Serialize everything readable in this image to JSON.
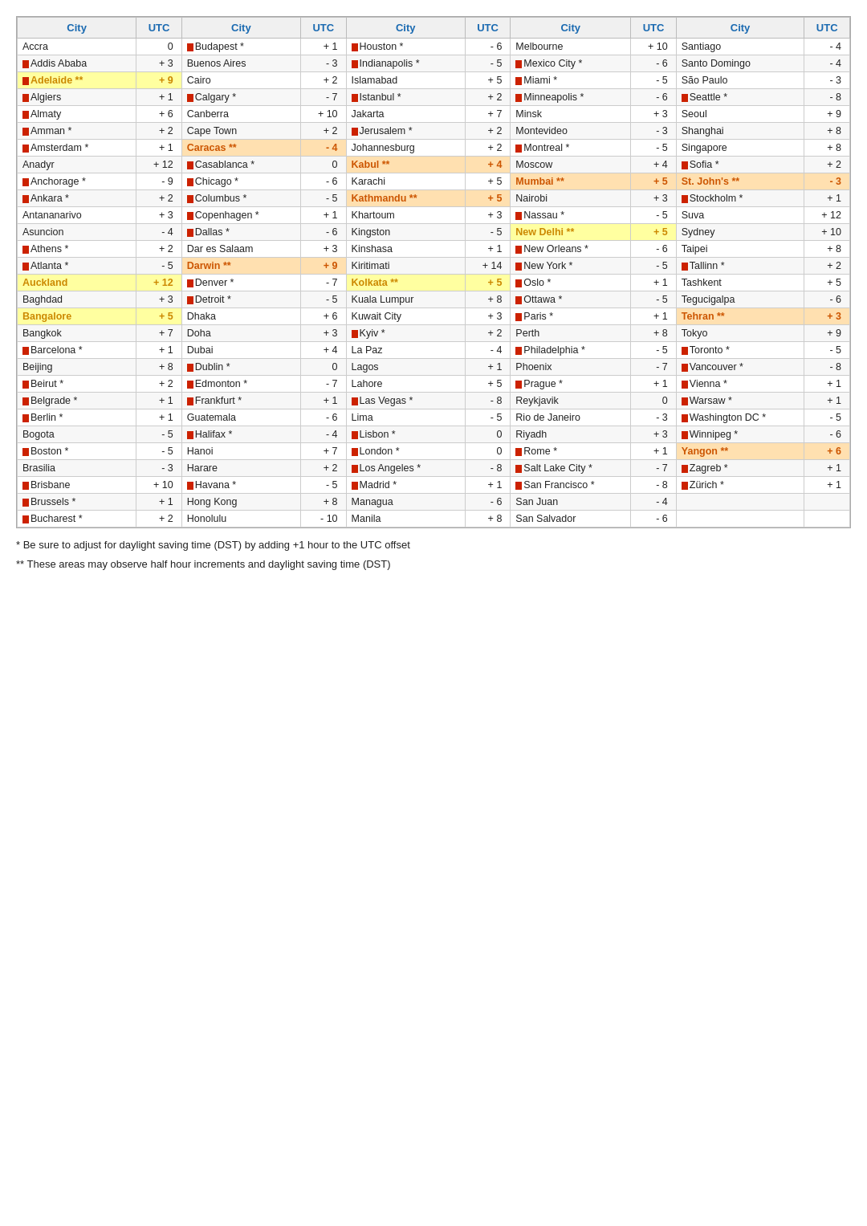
{
  "headers": [
    "City",
    "UTC",
    "City",
    "UTC",
    "City",
    "UTC",
    "City",
    "UTC",
    "City",
    "UTC"
  ],
  "columns": [
    [
      {
        "city": "Accra",
        "utc": "0",
        "flag": false,
        "highlight": ""
      },
      {
        "city": "Addis Ababa",
        "utc": "+ 3",
        "flag": true,
        "highlight": ""
      },
      {
        "city": "Adelaide **",
        "utc": "+ 9",
        "flag": true,
        "highlight": "yellow"
      },
      {
        "city": "Algiers",
        "utc": "+ 1",
        "flag": true,
        "highlight": ""
      },
      {
        "city": "Almaty",
        "utc": "+ 6",
        "flag": true,
        "highlight": ""
      },
      {
        "city": "Amman *",
        "utc": "+ 2",
        "flag": true,
        "highlight": ""
      },
      {
        "city": "Amsterdam *",
        "utc": "+ 1",
        "flag": true,
        "highlight": ""
      },
      {
        "city": "Anadyr",
        "utc": "+ 12",
        "flag": false,
        "highlight": ""
      },
      {
        "city": "Anchorage *",
        "utc": "- 9",
        "flag": true,
        "highlight": ""
      },
      {
        "city": "Ankara *",
        "utc": "+ 2",
        "flag": true,
        "highlight": ""
      },
      {
        "city": "Antananarivo",
        "utc": "+ 3",
        "flag": false,
        "highlight": ""
      },
      {
        "city": "Asuncion",
        "utc": "- 4",
        "flag": false,
        "highlight": ""
      },
      {
        "city": "Athens *",
        "utc": "+ 2",
        "flag": true,
        "highlight": ""
      },
      {
        "city": "Atlanta *",
        "utc": "- 5",
        "flag": true,
        "highlight": ""
      },
      {
        "city": "Auckland",
        "utc": "+ 12",
        "flag": false,
        "highlight": "yellow"
      },
      {
        "city": "Baghdad",
        "utc": "+ 3",
        "flag": false,
        "highlight": ""
      },
      {
        "city": "Bangalore",
        "utc": "+ 5",
        "flag": false,
        "highlight": "yellow"
      },
      {
        "city": "Bangkok",
        "utc": "+ 7",
        "flag": false,
        "highlight": ""
      },
      {
        "city": "Barcelona *",
        "utc": "+ 1",
        "flag": true,
        "highlight": ""
      },
      {
        "city": "Beijing",
        "utc": "+ 8",
        "flag": false,
        "highlight": ""
      },
      {
        "city": "Beirut *",
        "utc": "+ 2",
        "flag": true,
        "highlight": ""
      },
      {
        "city": "Belgrade *",
        "utc": "+ 1",
        "flag": true,
        "highlight": ""
      },
      {
        "city": "Berlin *",
        "utc": "+ 1",
        "flag": true,
        "highlight": ""
      },
      {
        "city": "Bogota",
        "utc": "- 5",
        "flag": false,
        "highlight": ""
      },
      {
        "city": "Boston *",
        "utc": "- 5",
        "flag": true,
        "highlight": ""
      },
      {
        "city": "Brasilia",
        "utc": "- 3",
        "flag": false,
        "highlight": ""
      },
      {
        "city": "Brisbane",
        "utc": "+ 10",
        "flag": true,
        "highlight": ""
      },
      {
        "city": "Brussels *",
        "utc": "+ 1",
        "flag": true,
        "highlight": ""
      },
      {
        "city": "Bucharest *",
        "utc": "+ 2",
        "flag": true,
        "highlight": ""
      }
    ],
    [
      {
        "city": "Budapest *",
        "utc": "+ 1",
        "flag": true,
        "highlight": ""
      },
      {
        "city": "Buenos Aires",
        "utc": "- 3",
        "flag": false,
        "highlight": ""
      },
      {
        "city": "Cairo",
        "utc": "+ 2",
        "flag": false,
        "highlight": ""
      },
      {
        "city": "Calgary *",
        "utc": "- 7",
        "flag": true,
        "highlight": ""
      },
      {
        "city": "Canberra",
        "utc": "+ 10",
        "flag": false,
        "highlight": ""
      },
      {
        "city": "Cape Town",
        "utc": "+ 2",
        "flag": false,
        "highlight": ""
      },
      {
        "city": "Caracas **",
        "utc": "- 4",
        "flag": false,
        "highlight": "orange"
      },
      {
        "city": "Casablanca *",
        "utc": "0",
        "flag": true,
        "highlight": ""
      },
      {
        "city": "Chicago *",
        "utc": "- 6",
        "flag": true,
        "highlight": ""
      },
      {
        "city": "Columbus *",
        "utc": "- 5",
        "flag": true,
        "highlight": ""
      },
      {
        "city": "Copenhagen *",
        "utc": "+ 1",
        "flag": true,
        "highlight": ""
      },
      {
        "city": "Dallas *",
        "utc": "- 6",
        "flag": true,
        "highlight": ""
      },
      {
        "city": "Dar es Salaam",
        "utc": "+ 3",
        "flag": false,
        "highlight": ""
      },
      {
        "city": "Darwin **",
        "utc": "+ 9",
        "flag": false,
        "highlight": "orange"
      },
      {
        "city": "Denver *",
        "utc": "- 7",
        "flag": true,
        "highlight": ""
      },
      {
        "city": "Detroit *",
        "utc": "- 5",
        "flag": true,
        "highlight": ""
      },
      {
        "city": "Dhaka",
        "utc": "+ 6",
        "flag": false,
        "highlight": ""
      },
      {
        "city": "Doha",
        "utc": "+ 3",
        "flag": false,
        "highlight": ""
      },
      {
        "city": "Dubai",
        "utc": "+ 4",
        "flag": false,
        "highlight": ""
      },
      {
        "city": "Dublin *",
        "utc": "0",
        "flag": true,
        "highlight": ""
      },
      {
        "city": "Edmonton *",
        "utc": "- 7",
        "flag": true,
        "highlight": ""
      },
      {
        "city": "Frankfurt *",
        "utc": "+ 1",
        "flag": true,
        "highlight": ""
      },
      {
        "city": "Guatemala",
        "utc": "- 6",
        "flag": false,
        "highlight": ""
      },
      {
        "city": "Halifax *",
        "utc": "- 4",
        "flag": true,
        "highlight": ""
      },
      {
        "city": "Hanoi",
        "utc": "+ 7",
        "flag": false,
        "highlight": ""
      },
      {
        "city": "Harare",
        "utc": "+ 2",
        "flag": false,
        "highlight": ""
      },
      {
        "city": "Havana *",
        "utc": "- 5",
        "flag": true,
        "highlight": ""
      },
      {
        "city": "Hong Kong",
        "utc": "+ 8",
        "flag": false,
        "highlight": ""
      },
      {
        "city": "Honolulu",
        "utc": "- 10",
        "flag": false,
        "highlight": ""
      }
    ],
    [
      {
        "city": "Houston *",
        "utc": "- 6",
        "flag": true,
        "highlight": ""
      },
      {
        "city": "Indianapolis *",
        "utc": "- 5",
        "flag": true,
        "highlight": ""
      },
      {
        "city": "Islamabad",
        "utc": "+ 5",
        "flag": false,
        "highlight": ""
      },
      {
        "city": "Istanbul *",
        "utc": "+ 2",
        "flag": true,
        "highlight": ""
      },
      {
        "city": "Jakarta",
        "utc": "+ 7",
        "flag": false,
        "highlight": ""
      },
      {
        "city": "Jerusalem *",
        "utc": "+ 2",
        "flag": true,
        "highlight": ""
      },
      {
        "city": "Johannesburg",
        "utc": "+ 2",
        "flag": false,
        "highlight": ""
      },
      {
        "city": "Kabul **",
        "utc": "+ 4",
        "flag": false,
        "highlight": "orange"
      },
      {
        "city": "Karachi",
        "utc": "+ 5",
        "flag": false,
        "highlight": ""
      },
      {
        "city": "Kathmandu **",
        "utc": "+ 5",
        "flag": false,
        "highlight": "orange"
      },
      {
        "city": "Khartoum",
        "utc": "+ 3",
        "flag": false,
        "highlight": ""
      },
      {
        "city": "Kingston",
        "utc": "- 5",
        "flag": false,
        "highlight": ""
      },
      {
        "city": "Kinshasa",
        "utc": "+ 1",
        "flag": false,
        "highlight": ""
      },
      {
        "city": "Kiritimati",
        "utc": "+ 14",
        "flag": false,
        "highlight": ""
      },
      {
        "city": "Kolkata **",
        "utc": "+ 5",
        "flag": false,
        "highlight": "yellow"
      },
      {
        "city": "Kuala Lumpur",
        "utc": "+ 8",
        "flag": false,
        "highlight": ""
      },
      {
        "city": "Kuwait City",
        "utc": "+ 3",
        "flag": false,
        "highlight": ""
      },
      {
        "city": "Kyiv *",
        "utc": "+ 2",
        "flag": true,
        "highlight": ""
      },
      {
        "city": "La Paz",
        "utc": "- 4",
        "flag": false,
        "highlight": ""
      },
      {
        "city": "Lagos",
        "utc": "+ 1",
        "flag": false,
        "highlight": ""
      },
      {
        "city": "Lahore",
        "utc": "+ 5",
        "flag": false,
        "highlight": ""
      },
      {
        "city": "Las Vegas *",
        "utc": "- 8",
        "flag": true,
        "highlight": ""
      },
      {
        "city": "Lima",
        "utc": "- 5",
        "flag": false,
        "highlight": ""
      },
      {
        "city": "Lisbon *",
        "utc": "0",
        "flag": true,
        "highlight": ""
      },
      {
        "city": "London *",
        "utc": "0",
        "flag": true,
        "highlight": ""
      },
      {
        "city": "Los Angeles *",
        "utc": "- 8",
        "flag": true,
        "highlight": ""
      },
      {
        "city": "Madrid *",
        "utc": "+ 1",
        "flag": true,
        "highlight": ""
      },
      {
        "city": "Managua",
        "utc": "- 6",
        "flag": false,
        "highlight": ""
      },
      {
        "city": "Manila",
        "utc": "+ 8",
        "flag": false,
        "highlight": ""
      }
    ],
    [
      {
        "city": "Melbourne",
        "utc": "+ 10",
        "flag": false,
        "highlight": ""
      },
      {
        "city": "Mexico City *",
        "utc": "- 6",
        "flag": true,
        "highlight": ""
      },
      {
        "city": "Miami *",
        "utc": "- 5",
        "flag": true,
        "highlight": ""
      },
      {
        "city": "Minneapolis *",
        "utc": "- 6",
        "flag": true,
        "highlight": ""
      },
      {
        "city": "Minsk",
        "utc": "+ 3",
        "flag": false,
        "highlight": ""
      },
      {
        "city": "Montevideo",
        "utc": "- 3",
        "flag": false,
        "highlight": ""
      },
      {
        "city": "Montreal *",
        "utc": "- 5",
        "flag": true,
        "highlight": ""
      },
      {
        "city": "Moscow",
        "utc": "+ 4",
        "flag": false,
        "highlight": ""
      },
      {
        "city": "Mumbai **",
        "utc": "+ 5",
        "flag": false,
        "highlight": "orange"
      },
      {
        "city": "Nairobi",
        "utc": "+ 3",
        "flag": false,
        "highlight": ""
      },
      {
        "city": "Nassau *",
        "utc": "- 5",
        "flag": true,
        "highlight": ""
      },
      {
        "city": "New Delhi **",
        "utc": "+ 5",
        "flag": false,
        "highlight": "yellow"
      },
      {
        "city": "New Orleans *",
        "utc": "- 6",
        "flag": true,
        "highlight": ""
      },
      {
        "city": "New York *",
        "utc": "- 5",
        "flag": true,
        "highlight": ""
      },
      {
        "city": "Oslo *",
        "utc": "+ 1",
        "flag": true,
        "highlight": ""
      },
      {
        "city": "Ottawa *",
        "utc": "- 5",
        "flag": true,
        "highlight": ""
      },
      {
        "city": "Paris *",
        "utc": "+ 1",
        "flag": true,
        "highlight": ""
      },
      {
        "city": "Perth",
        "utc": "+ 8",
        "flag": false,
        "highlight": ""
      },
      {
        "city": "Philadelphia *",
        "utc": "- 5",
        "flag": true,
        "highlight": ""
      },
      {
        "city": "Phoenix",
        "utc": "- 7",
        "flag": false,
        "highlight": ""
      },
      {
        "city": "Prague *",
        "utc": "+ 1",
        "flag": true,
        "highlight": ""
      },
      {
        "city": "Reykjavik",
        "utc": "0",
        "flag": false,
        "highlight": ""
      },
      {
        "city": "Rio de Janeiro",
        "utc": "- 3",
        "flag": false,
        "highlight": ""
      },
      {
        "city": "Riyadh",
        "utc": "+ 3",
        "flag": false,
        "highlight": ""
      },
      {
        "city": "Rome *",
        "utc": "+ 1",
        "flag": true,
        "highlight": ""
      },
      {
        "city": "Salt Lake City *",
        "utc": "- 7",
        "flag": true,
        "highlight": ""
      },
      {
        "city": "San Francisco *",
        "utc": "- 8",
        "flag": true,
        "highlight": ""
      },
      {
        "city": "San Juan",
        "utc": "- 4",
        "flag": false,
        "highlight": ""
      },
      {
        "city": "San Salvador",
        "utc": "- 6",
        "flag": false,
        "highlight": ""
      }
    ],
    [
      {
        "city": "Santiago",
        "utc": "- 4",
        "flag": false,
        "highlight": ""
      },
      {
        "city": "Santo Domingo",
        "utc": "- 4",
        "flag": false,
        "highlight": ""
      },
      {
        "city": "São Paulo",
        "utc": "- 3",
        "flag": false,
        "highlight": ""
      },
      {
        "city": "Seattle *",
        "utc": "- 8",
        "flag": true,
        "highlight": ""
      },
      {
        "city": "Seoul",
        "utc": "+ 9",
        "flag": false,
        "highlight": ""
      },
      {
        "city": "Shanghai",
        "utc": "+ 8",
        "flag": false,
        "highlight": ""
      },
      {
        "city": "Singapore",
        "utc": "+ 8",
        "flag": false,
        "highlight": ""
      },
      {
        "city": "Sofia *",
        "utc": "+ 2",
        "flag": true,
        "highlight": ""
      },
      {
        "city": "St. John's **",
        "utc": "- 3",
        "flag": false,
        "highlight": "orange"
      },
      {
        "city": "Stockholm *",
        "utc": "+ 1",
        "flag": true,
        "highlight": ""
      },
      {
        "city": "Suva",
        "utc": "+ 12",
        "flag": false,
        "highlight": ""
      },
      {
        "city": "Sydney",
        "utc": "+ 10",
        "flag": false,
        "highlight": ""
      },
      {
        "city": "Taipei",
        "utc": "+ 8",
        "flag": false,
        "highlight": ""
      },
      {
        "city": "Tallinn *",
        "utc": "+ 2",
        "flag": true,
        "highlight": ""
      },
      {
        "city": "Tashkent",
        "utc": "+ 5",
        "flag": false,
        "highlight": ""
      },
      {
        "city": "Tegucigalpa",
        "utc": "- 6",
        "flag": false,
        "highlight": ""
      },
      {
        "city": "Tehran **",
        "utc": "+ 3",
        "flag": false,
        "highlight": "orange"
      },
      {
        "city": "Tokyo",
        "utc": "+ 9",
        "flag": false,
        "highlight": ""
      },
      {
        "city": "Toronto *",
        "utc": "- 5",
        "flag": true,
        "highlight": ""
      },
      {
        "city": "Vancouver *",
        "utc": "- 8",
        "flag": true,
        "highlight": ""
      },
      {
        "city": "Vienna *",
        "utc": "+ 1",
        "flag": true,
        "highlight": ""
      },
      {
        "city": "Warsaw *",
        "utc": "+ 1",
        "flag": true,
        "highlight": ""
      },
      {
        "city": "Washington DC *",
        "utc": "- 5",
        "flag": true,
        "highlight": ""
      },
      {
        "city": "Winnipeg *",
        "utc": "- 6",
        "flag": true,
        "highlight": ""
      },
      {
        "city": "Yangon **",
        "utc": "+ 6",
        "flag": false,
        "highlight": "orange"
      },
      {
        "city": "Zagreb *",
        "utc": "+ 1",
        "flag": true,
        "highlight": ""
      },
      {
        "city": "Zürich *",
        "utc": "+ 1",
        "flag": true,
        "highlight": ""
      },
      {
        "city": "",
        "utc": "",
        "flag": false,
        "highlight": ""
      },
      {
        "city": "",
        "utc": "",
        "flag": false,
        "highlight": ""
      }
    ]
  ],
  "footnotes": {
    "note1": "* Be sure to adjust for daylight saving time (DST) by adding +1 hour to the UTC offset",
    "note2": "** These areas may observe half hour increments and daylight saving time (DST)"
  }
}
